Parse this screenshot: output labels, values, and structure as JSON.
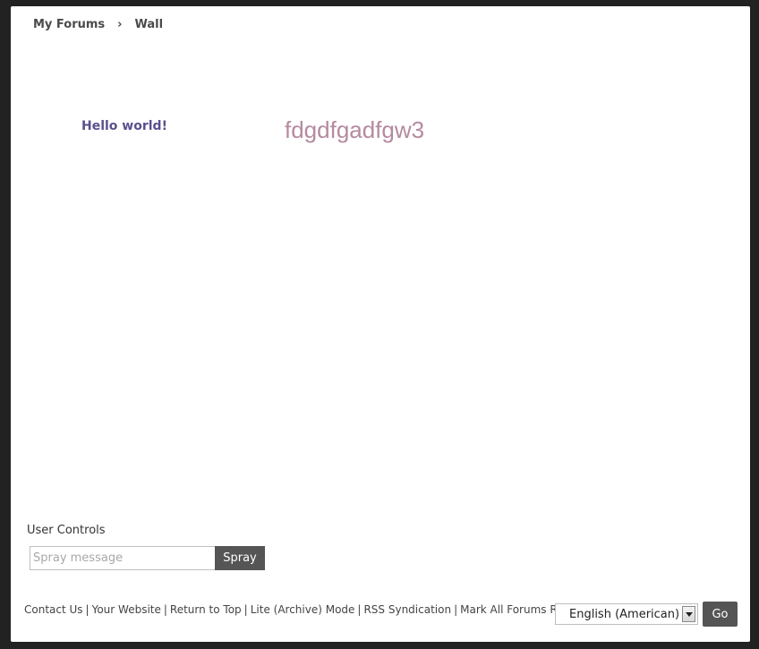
{
  "breadcrumb": {
    "items": [
      "My Forums",
      "Wall"
    ],
    "separator": "›"
  },
  "wall": {
    "sprays": [
      {
        "text": "Hello world!",
        "color": "#5b4f8c"
      },
      {
        "text": "fdgdfgadfgw3",
        "color": "#b48aa0"
      }
    ]
  },
  "user_controls": {
    "title": "User Controls",
    "spray_placeholder": "Spray message",
    "spray_value": "",
    "spray_button": "Spray"
  },
  "footer": {
    "links": [
      "Contact Us",
      "Your Website",
      "Return to Top",
      "Lite (Archive) Mode",
      "RSS Syndication",
      "Mark All Forums Read"
    ],
    "separator": "|",
    "language": {
      "selected": "English (American)",
      "icon": "chevron-down-icon"
    },
    "go_button": "Go"
  },
  "colors": {
    "background": "#222222",
    "page": "#ffffff",
    "button": "#555555"
  }
}
